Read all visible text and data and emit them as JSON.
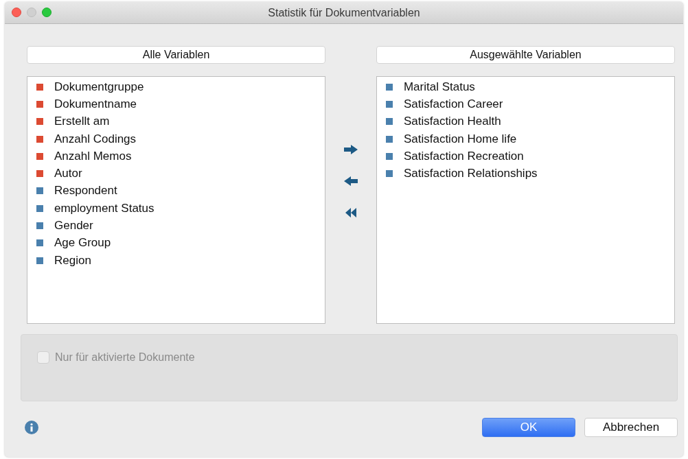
{
  "window": {
    "title": "Statistik für Dokumentvariablen"
  },
  "left_list": {
    "header": "Alle Variablen",
    "items": [
      {
        "label": "Dokumentgruppe",
        "color": "#dc4a32"
      },
      {
        "label": "Dokumentname",
        "color": "#dc4a32"
      },
      {
        "label": "Erstellt am",
        "color": "#dc4a32"
      },
      {
        "label": "Anzahl Codings",
        "color": "#dc4a32"
      },
      {
        "label": "Anzahl Memos",
        "color": "#dc4a32"
      },
      {
        "label": "Autor",
        "color": "#dc4a32"
      },
      {
        "label": "Respondent",
        "color": "#4a80ad"
      },
      {
        "label": "employment Status",
        "color": "#4a80ad"
      },
      {
        "label": "Gender",
        "color": "#4a80ad"
      },
      {
        "label": "Age Group",
        "color": "#4a80ad"
      },
      {
        "label": "Region",
        "color": "#4a80ad"
      }
    ]
  },
  "right_list": {
    "header": "Ausgewählte Variablen",
    "items": [
      {
        "label": "Marital Status",
        "color": "#4a80ad"
      },
      {
        "label": "Satisfaction Career",
        "color": "#4a80ad"
      },
      {
        "label": "Satisfaction Health",
        "color": "#4a80ad"
      },
      {
        "label": "Satisfaction Home life",
        "color": "#4a80ad"
      },
      {
        "label": "Satisfaction Recreation",
        "color": "#4a80ad"
      },
      {
        "label": "Satisfaction Relationships",
        "color": "#4a80ad"
      }
    ]
  },
  "options": {
    "checkbox": {
      "label": "Nur für aktivierte Dokumente",
      "checked": false,
      "disabled": true
    }
  },
  "buttons": [
    {
      "label": "OK",
      "default": true
    },
    {
      "label": "Abbrechen",
      "default": false
    }
  ]
}
